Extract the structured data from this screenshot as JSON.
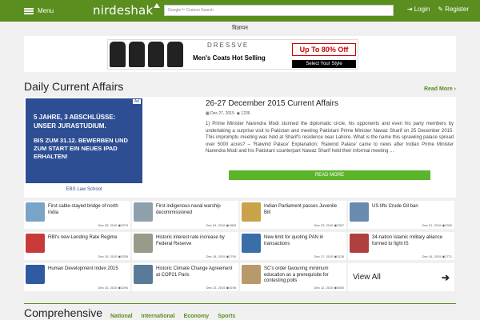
{
  "header": {
    "menu_label": "Menu",
    "logo": "nirdeshak",
    "search_placeholder": "Google™ Custom Search",
    "login_label": "Login",
    "register_label": "Register"
  },
  "ad_top": {
    "label": "विज्ञापन",
    "brand": "DRESSVE",
    "headline": "Men's Coats Hot Selling",
    "offer": "Up To 80% Off",
    "cta": "Select Your Style"
  },
  "section1": {
    "title": "Daily Current Affairs",
    "read_more": "Read More ›"
  },
  "featured": {
    "ad_line1": "5 JAHRE, 3 ABSCHLÜSSE: UNSER JURASTUDIUM.",
    "ad_line2": "BIS ZUM 31.12. BEWERBEN UND ZUM START EIN NEUES IPAD ERHALTEN!",
    "ad_footer": "EBS Law School",
    "ad_tag": "Ad",
    "title": "26-27 December 2015 Current Affairs",
    "date": "Dec 27, 2015",
    "views": "1236",
    "excerpt": "1) Prime Minister Narendra Modi stunned the diplomatic circle, his opponents and even his party members by undertaking a surprise visit to Pakistan and meeting Pakistani Prime Minister Nawaz Sharif on 25 December 2015. This impromptu meeting was held at Sharif's residence near Lahore. What is the name this sprawling palace spread over 5000 acres? – 'Raiwind Palace' Explanation: 'Raiwind Palace' came to news after Indian Prime Minister Narendra Modi and his Pakistani counterpart Nawaz Sharif held their informal meeting ...",
    "button": "READ MORE"
  },
  "articles": [
    {
      "title": "First cable-stayed bridge of north India",
      "date": "Dec 25, 2015",
      "views": "2579",
      "color": "#7aa3c8"
    },
    {
      "title": "First indigenous naval warship decommissioned",
      "date": "Dec 24, 2015",
      "views": "1883",
      "color": "#8fa0ad"
    },
    {
      "title": "Indian Parliament passes Juvenile Bill",
      "date": "Dec 23, 2015",
      "views": "2307",
      "color": "#c9a24a"
    },
    {
      "title": "US lifts Crude Oil ban",
      "date": "Dec 21, 2015",
      "views": "2390",
      "color": "#6a8bb0"
    },
    {
      "title": "RBI's new Lending Rate Regime",
      "date": "Dec 19, 2015",
      "views": "3255",
      "color": "#c83a3a"
    },
    {
      "title": "Historic interest rate increase by Federal Reserve",
      "date": "Dec 18, 2015",
      "views": "2790",
      "color": "#9a9a8a"
    },
    {
      "title": "New limit for quoting PAN in transactions",
      "date": "Dec 17, 2015",
      "views": "3128",
      "color": "#3a6ea8"
    },
    {
      "title": "34-nation Islamic military alliance formed to fight IS",
      "date": "Dec 16, 2015",
      "views": "2771",
      "color": "#b04040"
    },
    {
      "title": "Human Development Index 2015",
      "date": "Dec 15, 2015",
      "views": "3294",
      "color": "#2d5aa0"
    },
    {
      "title": "Historic Climate Change Agreement at COP21 Paris",
      "date": "Dec 13, 2015",
      "views": "3198",
      "color": "#5a7a9a"
    },
    {
      "title": "SC's order favouring minimum education as a prerequisite for contesting polls",
      "date": "Dec 12, 2015",
      "views": "3550",
      "color": "#b89a6a"
    }
  ],
  "view_all": "View All",
  "section2": {
    "title": "Comprehensive",
    "tabs": [
      "National",
      "International",
      "Economy",
      "Sports"
    ]
  }
}
